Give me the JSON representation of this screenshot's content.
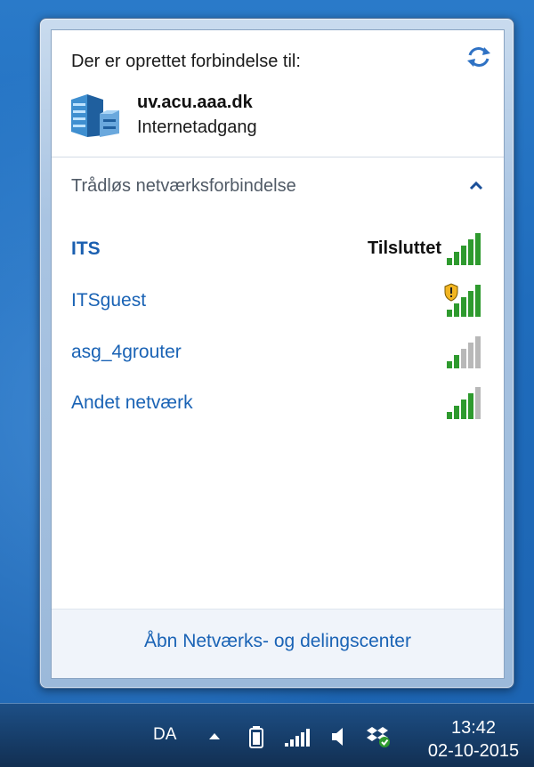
{
  "flyout": {
    "header": {
      "title": "Der er oprettet forbindelse til:",
      "connection_name": "uv.acu.aaa.dk",
      "connection_access": "Internetadgang"
    },
    "wireless": {
      "group_title": "Trådløs netværksforbindelse",
      "networks": [
        {
          "name": "ITS",
          "status": "Tilsluttet",
          "bars": 5,
          "secured_warning": false,
          "active": true
        },
        {
          "name": "ITSguest",
          "status": "",
          "bars": 5,
          "secured_warning": true,
          "active": false
        },
        {
          "name": "asg_4grouter",
          "status": "",
          "bars": 2,
          "secured_warning": false,
          "active": false
        },
        {
          "name": "Andet netværk",
          "status": "",
          "bars": 4,
          "secured_warning": false,
          "active": false
        }
      ]
    },
    "footer": {
      "link_label": "Åbn Netværks- og delingscenter"
    }
  },
  "taskbar": {
    "language": "DA",
    "time": "13:42",
    "date": "02-10-2015",
    "icons": [
      "show-hidden-icons-icon",
      "battery-icon",
      "network-signal-icon",
      "volume-icon",
      "dropbox-icon"
    ]
  },
  "colors": {
    "link": "#1a63b5",
    "signal_on": "#2e9a2e",
    "signal_off": "#b8b8b8",
    "taskbar": "#173f6c"
  }
}
